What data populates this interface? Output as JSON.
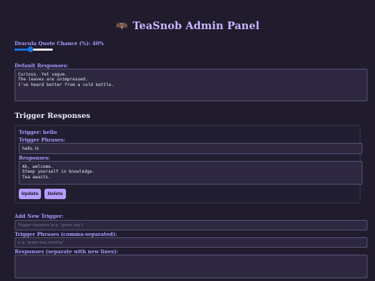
{
  "header": {
    "bat_glyph": "🦇",
    "title": "TeaSnob Admin Panel"
  },
  "dracula": {
    "label": "Dracula Quote Chance (%): 40%",
    "value": 40
  },
  "defaults": {
    "label": "Default Responses:",
    "value": "Curious. Yet vague.\nThe leaves are unimpressed.\nI've heard better from a cold kettle."
  },
  "triggers": {
    "section_title": "Trigger Responses",
    "items": [
      {
        "trigger_label": "Trigger: hello",
        "phrases_label": "Trigger Phrases:",
        "phrases_value": "hello, hi",
        "responses_label": "Responses:",
        "responses_value": "Ah, welcome.\nSteep yourself in knowledge.\nTea awaits.",
        "update_label": "Update",
        "delete_label": "Delete"
      }
    ]
  },
  "new_trigger": {
    "label": "Add New Trigger:",
    "keyword_placeholder": "Trigger keyword (e.g. 'green tea')",
    "phrases_label": "Trigger Phrases (comma-separated):",
    "phrases_placeholder": "e.g. 'green tea,matcha'",
    "responses_label": "Responses (separate with new lines):"
  }
}
